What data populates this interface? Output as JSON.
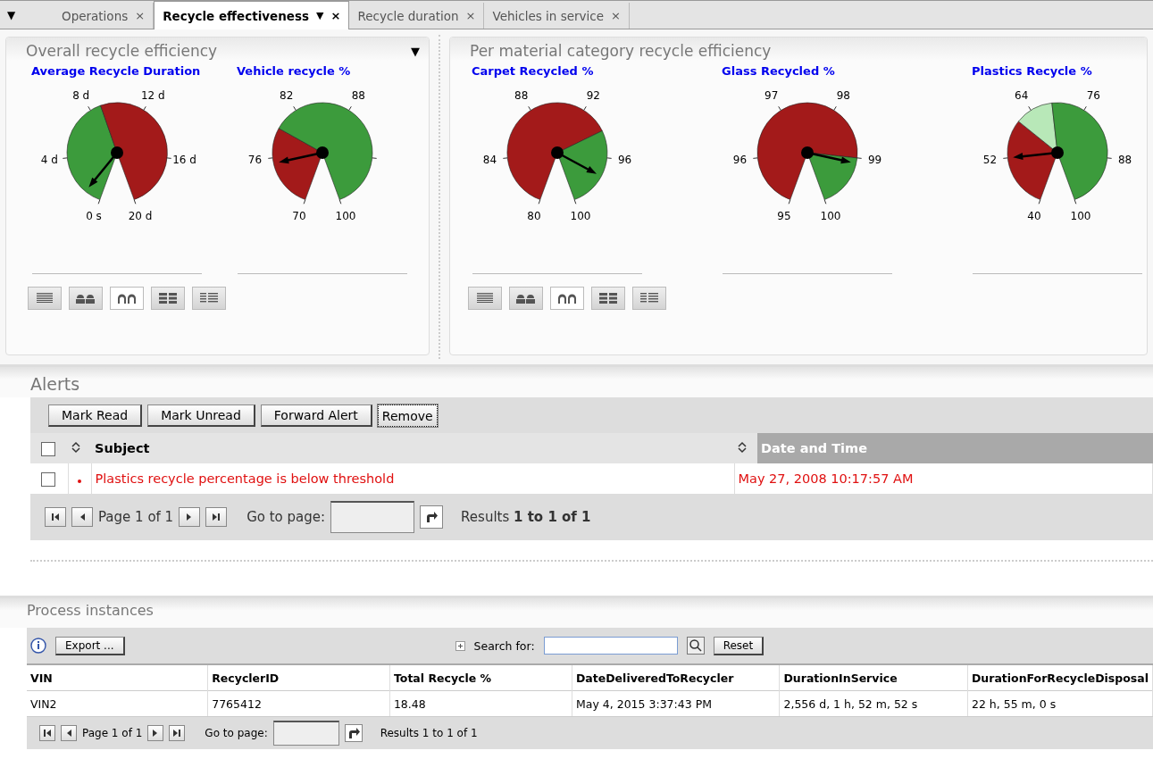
{
  "tab_menu": "▼",
  "tabs": [
    {
      "label": "Operations",
      "selected": false,
      "close": "×"
    },
    {
      "label": "Recycle effectiveness",
      "selected": true,
      "menu": "▼",
      "close": "×"
    },
    {
      "label": "Recycle duration",
      "selected": false,
      "close": "×"
    },
    {
      "label": "Vehicles in service",
      "selected": false,
      "close": "×"
    }
  ],
  "portlets": [
    {
      "title": "Overall recycle efficiency",
      "menu": "▼",
      "gauges": [
        {
          "title": "Average Recycle Duration",
          "ticks": [
            "0 s",
            "4 d",
            "8 d",
            "12 d",
            "16 d",
            "20 d"
          ],
          "zones": [
            {
              "color": "#3c9b3c"
            },
            {
              "color": "#a31a1a"
            }
          ]
        },
        {
          "title": "Vehicle recycle %",
          "ticks": [
            "70",
            "76",
            "82",
            "88",
            "100"
          ],
          "zones": [
            {
              "color": "#a31a1a"
            },
            {
              "color": "#3c9b3c"
            }
          ]
        }
      ],
      "layout_buttons": [
        {
          "kind": "rows",
          "selected": false
        },
        {
          "kind": "pairs",
          "selected": false
        },
        {
          "kind": "arches",
          "selected": true
        },
        {
          "kind": "grid",
          "selected": false
        },
        {
          "kind": "list",
          "selected": false
        }
      ]
    },
    {
      "title": "Per material category recycle efficiency",
      "gauges": [
        {
          "title": "Carpet Recycled %",
          "ticks": [
            "80",
            "84",
            "88",
            "92",
            "96",
            "100"
          ],
          "zones": [
            {
              "color": "#a31a1a"
            },
            {
              "color": "#3c9b3c"
            }
          ]
        },
        {
          "title": "Glass Recycled %",
          "ticks": [
            "95",
            "96",
            "97",
            "98",
            "99",
            "100"
          ],
          "zones": [
            {
              "color": "#a31a1a"
            },
            {
              "color": "#3c9b3c"
            }
          ]
        },
        {
          "title": "Plastics Recycle %",
          "ticks": [
            "40",
            "52",
            "64",
            "76",
            "88",
            "100"
          ],
          "zones": [
            {
              "color": "#a31a1a"
            },
            {
              "color": "#b8e8b8"
            },
            {
              "color": "#3c9b3c"
            }
          ]
        }
      ],
      "layout_buttons": [
        {
          "kind": "rows",
          "selected": false
        },
        {
          "kind": "pairs",
          "selected": false
        },
        {
          "kind": "arches",
          "selected": true
        },
        {
          "kind": "grid",
          "selected": false
        },
        {
          "kind": "list",
          "selected": false
        }
      ]
    }
  ],
  "alerts": {
    "title": "Alerts",
    "select_all_checked": false,
    "actions": [
      "Mark Read",
      "Mark Unread",
      "Forward Alert",
      "Remove"
    ],
    "columns": [
      {
        "label": "Subject",
        "sorted": false
      },
      {
        "label": "Date and Time",
        "sorted": true
      }
    ],
    "rows": [
      {
        "checked": false,
        "unread": true,
        "subject": "Plastics recycle percentage is below threshold",
        "date": "May 27, 2008 10:17:57 AM"
      }
    ],
    "pager": {
      "page": "Page 1 of 1",
      "goto_label": "Go to page:",
      "results": "Results **1 to 1 of 1**"
    }
  },
  "process": {
    "title": "Process instances",
    "export": "Export ...",
    "search_label": "Search for:",
    "reset": "Reset",
    "columns": [
      "VIN",
      "RecyclerID",
      "Total Recycle %",
      "DateDeliveredToRecycler",
      "DurationInService",
      "DurationForRecycleDisposal"
    ],
    "rows": [
      [
        "VIN2",
        "7765412",
        "18.48",
        "May 4, 2015 3:37:43 PM",
        "2,556 d, 1 h, 52 m, 52 s",
        "22 h, 55 m, 0 s"
      ]
    ],
    "pager": {
      "page": "Page 1 of 1",
      "goto_label": "Go to page:",
      "results": "Results 1 to 1 of 1"
    }
  }
}
